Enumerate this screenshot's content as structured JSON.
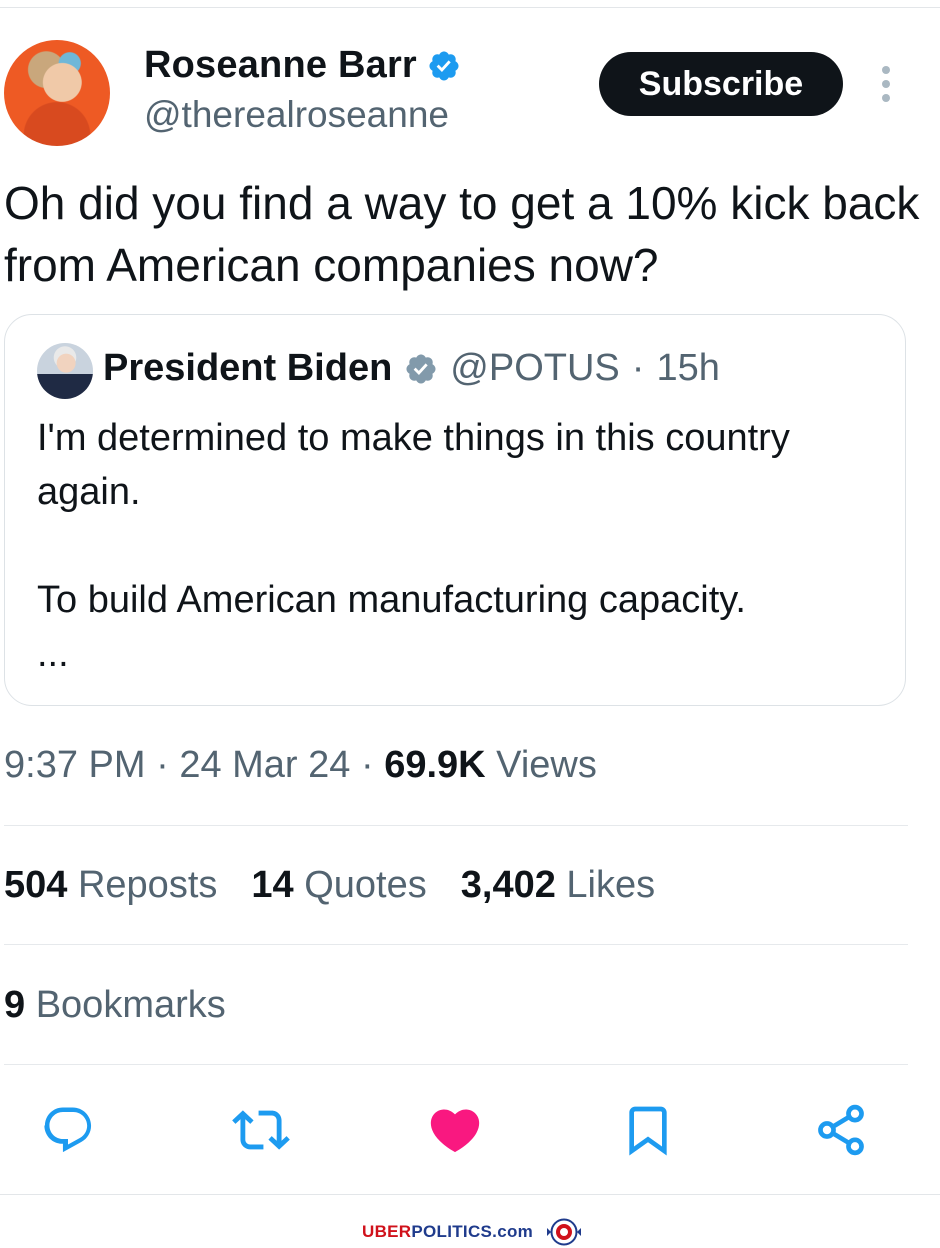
{
  "author": {
    "display_name": "Roseanne Barr",
    "handle": "@therealroseanne",
    "subscribe_label": "Subscribe"
  },
  "tweet": {
    "text": "Oh did you find a way to get a 10% kick back from American companies now?"
  },
  "quoted_tweet": {
    "display_name": "President Biden",
    "handle": "@POTUS",
    "separator": "·",
    "age": "15h",
    "body": "I'm determined to make things in this country again.\n\nTo build American manufacturing capacity.\n..."
  },
  "meta": {
    "time": "9:37 PM",
    "sep1": "·",
    "date": "24 Mar 24",
    "sep2": "·",
    "views_count": "69.9K",
    "views_label": "Views"
  },
  "stats": {
    "reposts_count": "504",
    "reposts_label": "Reposts",
    "quotes_count": "14",
    "quotes_label": "Quotes",
    "likes_count": "3,402",
    "likes_label": "Likes",
    "bookmarks_count": "9",
    "bookmarks_label": "Bookmarks"
  },
  "actions": [
    "reply-icon",
    "repost-icon",
    "heart-icon",
    "bookmark-icon",
    "share-icon"
  ],
  "colors": {
    "verified_blue": "#1d9bf0",
    "verified_gray": "#829aab",
    "like_pink": "#f91880",
    "icon_blue": "#1d9bf0",
    "secondary_text": "#536471"
  },
  "watermark": {
    "part1": "UBER",
    "part2": "POLITICS",
    "part3": ".com"
  }
}
